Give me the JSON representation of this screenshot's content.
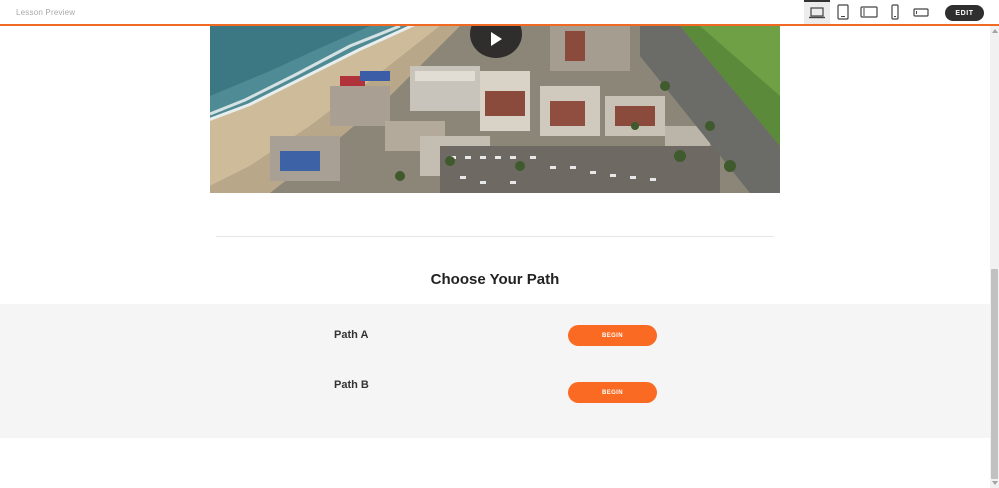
{
  "toolbar": {
    "title": "Lesson Preview",
    "devices": [
      {
        "icon": "laptop-icon",
        "active": true
      },
      {
        "icon": "tablet-portrait-icon",
        "active": false
      },
      {
        "icon": "tablet-landscape-icon",
        "active": false
      },
      {
        "icon": "phone-portrait-icon",
        "active": false
      },
      {
        "icon": "phone-landscape-icon",
        "active": false
      }
    ],
    "edit_label": "EDIT"
  },
  "video": {
    "play_icon": "play-icon"
  },
  "section": {
    "heading": "Choose Your Path",
    "paths": [
      {
        "label": "Path A",
        "button_label": "BEGIN"
      },
      {
        "label": "Path B",
        "button_label": "BEGIN"
      }
    ]
  },
  "colors": {
    "accent": "#fb6a22",
    "toolbar_border": "#f06a24",
    "edit_button": "#2f2f2f",
    "panel_bg": "#f5f5f5"
  }
}
